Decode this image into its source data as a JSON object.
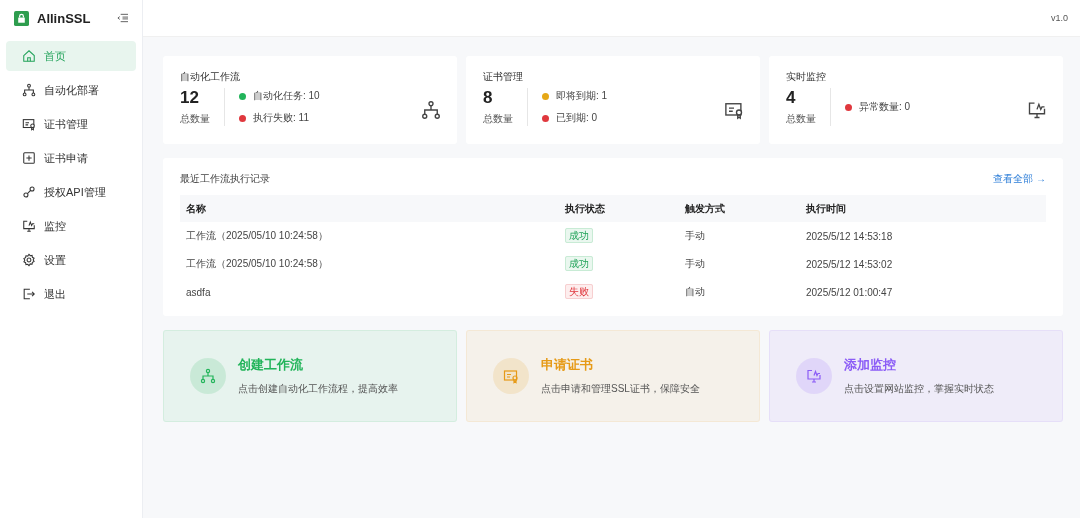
{
  "brand": {
    "name": "AllinSSL"
  },
  "version": "v1.0",
  "nav": [
    {
      "label": "首页",
      "selected": true
    },
    {
      "label": "自动化部署",
      "selected": false
    },
    {
      "label": "证书管理",
      "selected": false
    },
    {
      "label": "证书申请",
      "selected": false
    },
    {
      "label": "授权API管理",
      "selected": false
    },
    {
      "label": "监控",
      "selected": false
    },
    {
      "label": "设置",
      "selected": false
    },
    {
      "label": "退出",
      "selected": false
    }
  ],
  "stats": [
    {
      "title": "自动化工作流",
      "total": "12",
      "total_label": "总数量",
      "items": [
        {
          "label": "自动化任务: 10",
          "color": "#22b45a"
        },
        {
          "label": "执行失败: 11",
          "color": "#e0383e"
        }
      ]
    },
    {
      "title": "证书管理",
      "total": "8",
      "total_label": "总数量",
      "items": [
        {
          "label": "即将到期: 1",
          "color": "#e6a817"
        },
        {
          "label": "已到期: 0",
          "color": "#e0383e"
        }
      ]
    },
    {
      "title": "实时监控",
      "total": "4",
      "total_label": "总数量",
      "items": [
        {
          "label": "异常数量: 0",
          "color": "#e0383e"
        }
      ]
    }
  ],
  "records": {
    "title": "最近工作流执行记录",
    "link": "查看全部 →",
    "columns": [
      "名称",
      "执行状态",
      "触发方式",
      "执行时间"
    ],
    "rows": [
      {
        "name": "工作流（2025/05/10 10:24:58）",
        "status": "成功",
        "kind": "success",
        "trigger": "手动",
        "time": "2025/5/12 14:53:18"
      },
      {
        "name": "工作流（2025/05/10 10:24:58）",
        "status": "成功",
        "kind": "success",
        "trigger": "手动",
        "time": "2025/5/12 14:53:02"
      },
      {
        "name": "asdfa",
        "status": "失败",
        "kind": "fail",
        "trigger": "自动",
        "time": "2025/5/12 01:00:47"
      }
    ]
  },
  "actions": [
    {
      "title": "创建工作流",
      "desc": "点击创建自动化工作流程，提高效率",
      "color": "#22b45a"
    },
    {
      "title": "申请证书",
      "desc": "点击申请和管理SSL证书，保障安全",
      "color": "#e69a17"
    },
    {
      "title": "添加监控",
      "desc": "点击设置网站监控，掌握实时状态",
      "color": "#8b5cf6"
    }
  ]
}
